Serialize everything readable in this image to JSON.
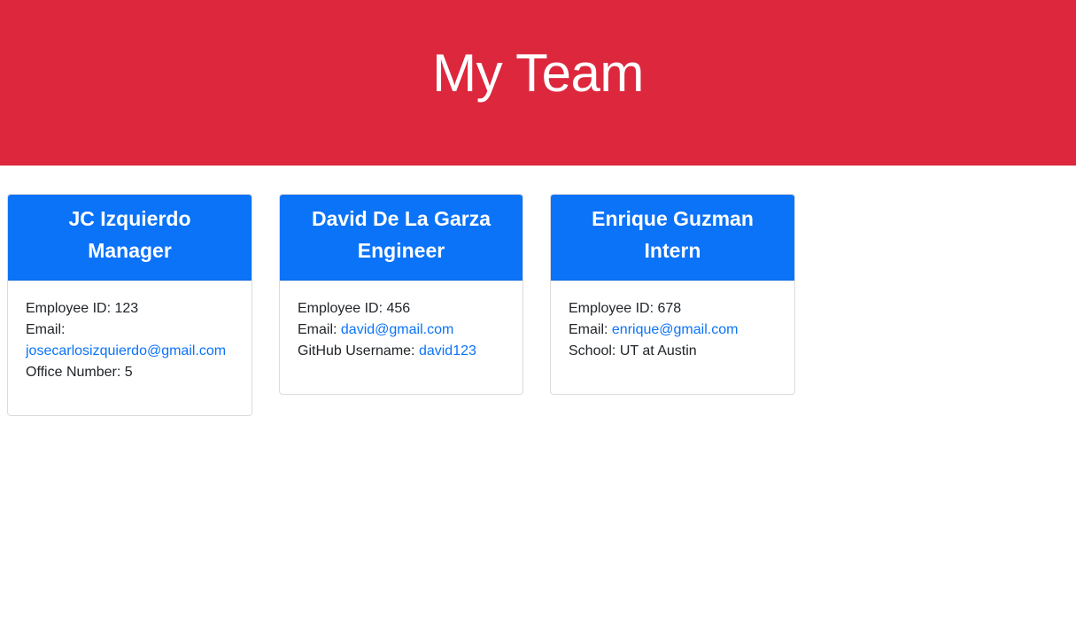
{
  "header": {
    "title": "My Team"
  },
  "employees": [
    {
      "name": "JC Izquierdo",
      "role": "Manager",
      "id_label": "Employee ID:",
      "id": "123",
      "email_label": "Email:",
      "email": "josecarlosizquierdo@gmail.com",
      "extra_label": "Office Number:",
      "extra_value": "5"
    },
    {
      "name": "David De La Garza",
      "role": "Engineer",
      "id_label": "Employee ID:",
      "id": "456",
      "email_label": "Email:",
      "email": "david@gmail.com",
      "extra_label": "GitHub Username:",
      "extra_value": "david123"
    },
    {
      "name": "Enrique Guzman",
      "role": "Intern",
      "id_label": "Employee ID:",
      "id": "678",
      "email_label": "Email:",
      "email": "enrique@gmail.com",
      "extra_label": "School:",
      "extra_value": "UT at Austin"
    }
  ],
  "colors": {
    "header_bg": "#dc273d",
    "card_header_bg": "#0b73f8",
    "link": "#0b73f8"
  }
}
